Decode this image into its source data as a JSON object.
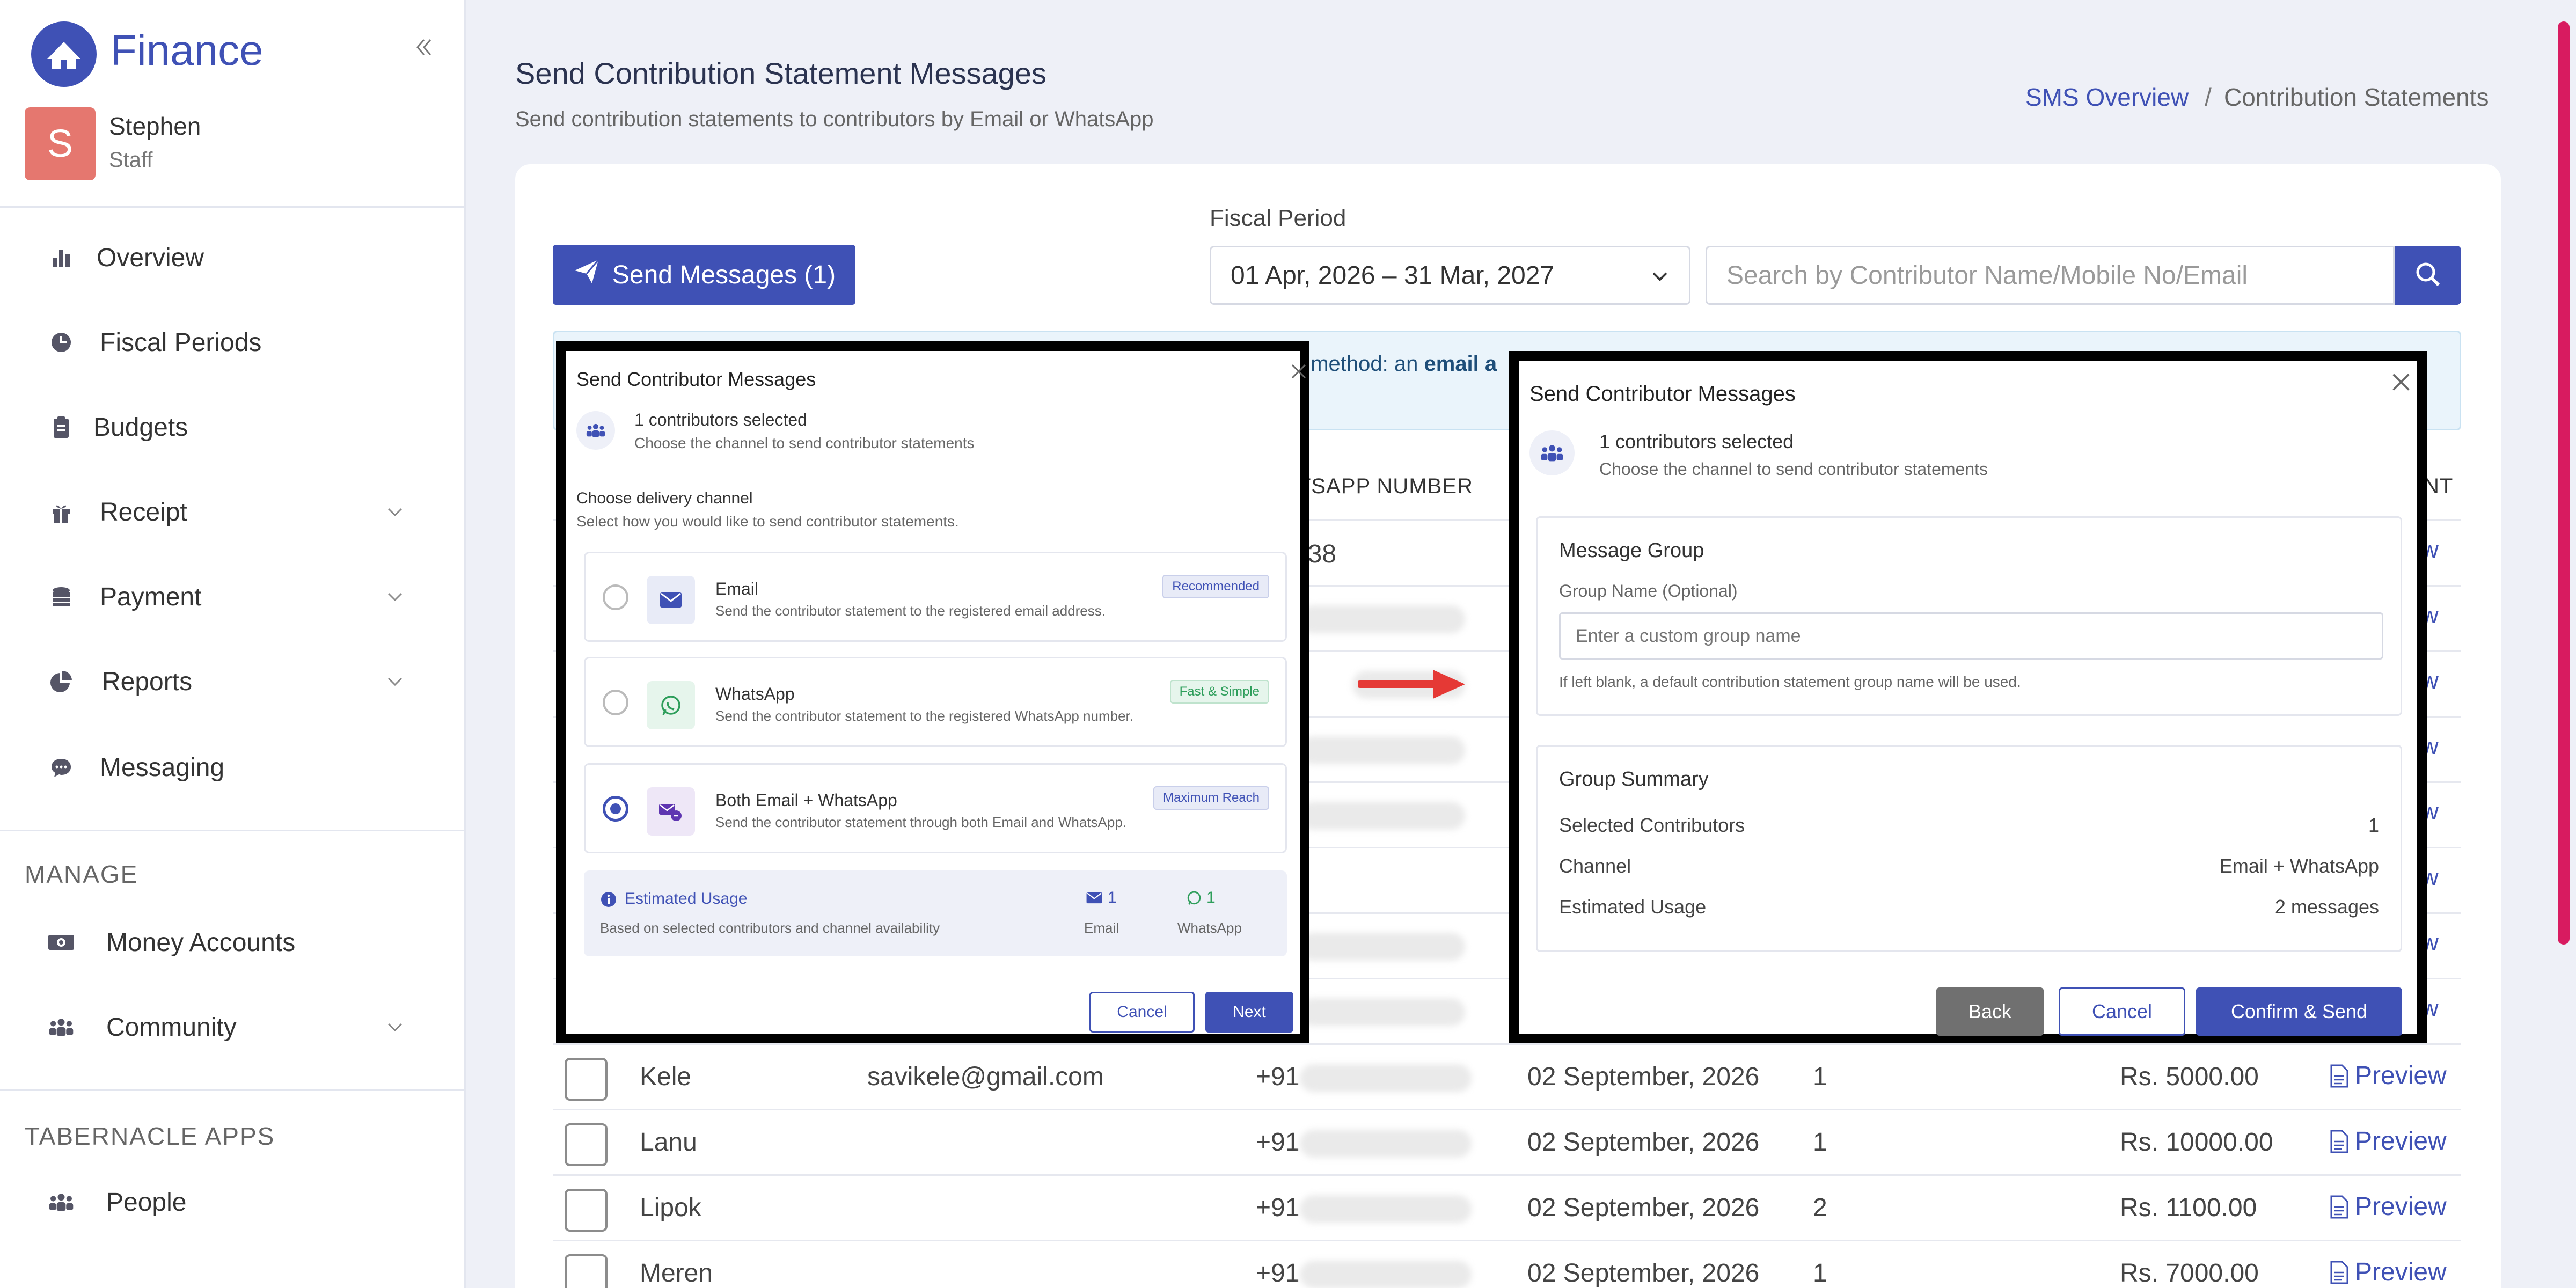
{
  "app": {
    "name": "Finance",
    "collapse_icon": "chevrons-left-icon"
  },
  "user": {
    "initial": "S",
    "name": "Stephen",
    "role": "Staff"
  },
  "sidebar": {
    "items": [
      {
        "label": "Overview",
        "icon": "bar-chart-icon"
      },
      {
        "label": "Fiscal Periods",
        "icon": "clock-icon"
      },
      {
        "label": "Budgets",
        "icon": "clipboard-icon"
      },
      {
        "label": "Receipt",
        "icon": "gift-icon",
        "expandable": true
      },
      {
        "label": "Payment",
        "icon": "coins-icon",
        "expandable": true
      },
      {
        "label": "Reports",
        "icon": "pie-chart-icon",
        "expandable": true
      },
      {
        "label": "Messaging",
        "icon": "chat-icon"
      }
    ],
    "manage_title": "MANAGE",
    "manage_items": [
      {
        "label": "Money Accounts",
        "icon": "money-icon"
      },
      {
        "label": "Community",
        "icon": "users-icon",
        "expandable": true
      }
    ],
    "apps_title": "TABERNACLE APPS",
    "apps_items": [
      {
        "label": "People",
        "icon": "users-icon"
      }
    ]
  },
  "header": {
    "title": "Send Contribution Statement Messages",
    "subtitle": "Send contribution statements to contributors by Email or WhatsApp",
    "breadcrumb": [
      "SMS Overview",
      "/",
      "Contribution Statements"
    ]
  },
  "toolbar": {
    "send_label": "Send Messages (1)",
    "fiscal_label": "Fiscal Period",
    "fiscal_value": "01 Apr, 2026 – 31 Mar, 2027",
    "search_placeholder": "Search by Contributor Name/Mobile No/Email"
  },
  "info": {
    "text_prefix": "ct method: an",
    "text_bold": "email a"
  },
  "table": {
    "headers": {
      "whatsapp": "TSAPP NUMBER",
      "last": "NT"
    },
    "partial_row_value": "938",
    "preview_label": "Preview",
    "rows": [
      {
        "name": "Kele",
        "email": "savikele@gmail.com",
        "phone": "+91",
        "date": "02 September, 2026",
        "count": "1",
        "amount": "Rs. 5000.00"
      },
      {
        "name": "Lanu",
        "email": "",
        "phone": "+91",
        "date": "02 September, 2026",
        "count": "1",
        "amount": "Rs. 10000.00"
      },
      {
        "name": "Lipok",
        "email": "",
        "phone": "+91",
        "date": "02 September, 2026",
        "count": "2",
        "amount": "Rs. 1100.00"
      },
      {
        "name": "Meren",
        "email": "",
        "phone": "+91",
        "date": "02 September, 2026",
        "count": "1",
        "amount": "Rs. 7000.00"
      }
    ],
    "hidden_preview_count": 8
  },
  "modal_channel": {
    "title": "Send Contributor Messages",
    "selected_text": "1 contributors selected",
    "selected_sub": "Choose the channel to send contributor statements",
    "choose_title": "Choose delivery channel",
    "choose_sub": "Select how you would like to send contributor statements.",
    "options": [
      {
        "title": "Email",
        "desc": "Send the contributor statement to the registered email address.",
        "badge": "Recommended",
        "selected": false
      },
      {
        "title": "WhatsApp",
        "desc": "Send the contributor statement to the registered WhatsApp number.",
        "badge": "Fast & Simple",
        "selected": false
      },
      {
        "title": "Both Email + WhatsApp",
        "desc": "Send the contributor statement through both Email and WhatsApp.",
        "badge": "Maximum Reach",
        "selected": true
      }
    ],
    "usage_title": "Estimated Usage",
    "usage_sub": "Based on selected contributors and channel availability",
    "usage_email_count": "1",
    "usage_email_label": "Email",
    "usage_whatsapp_count": "1",
    "usage_whatsapp_label": "WhatsApp",
    "cancel_label": "Cancel",
    "next_label": "Next"
  },
  "modal_confirm": {
    "title": "Send Contributor Messages",
    "selected_text": "1 contributors selected",
    "selected_sub": "Choose the channel to send contributor statements",
    "group_title": "Message Group",
    "group_label": "Group Name (Optional)",
    "group_placeholder": "Enter a custom group name",
    "group_hint": "If left blank, a default contribution statement group name will be used.",
    "summary_title": "Group Summary",
    "summary": [
      {
        "label": "Selected Contributors",
        "value": "1"
      },
      {
        "label": "Channel",
        "value": "Email + WhatsApp"
      },
      {
        "label": "Estimated Usage",
        "value": "2 messages"
      }
    ],
    "back_label": "Back",
    "cancel_label": "Cancel",
    "confirm_label": "Confirm & Send"
  },
  "colors": {
    "primary": "#3f51b5",
    "avatar": "#e5776f",
    "arrow": "#e53935",
    "scroll_accent": "#d81b60",
    "badge_green": "#2e9e5b"
  }
}
